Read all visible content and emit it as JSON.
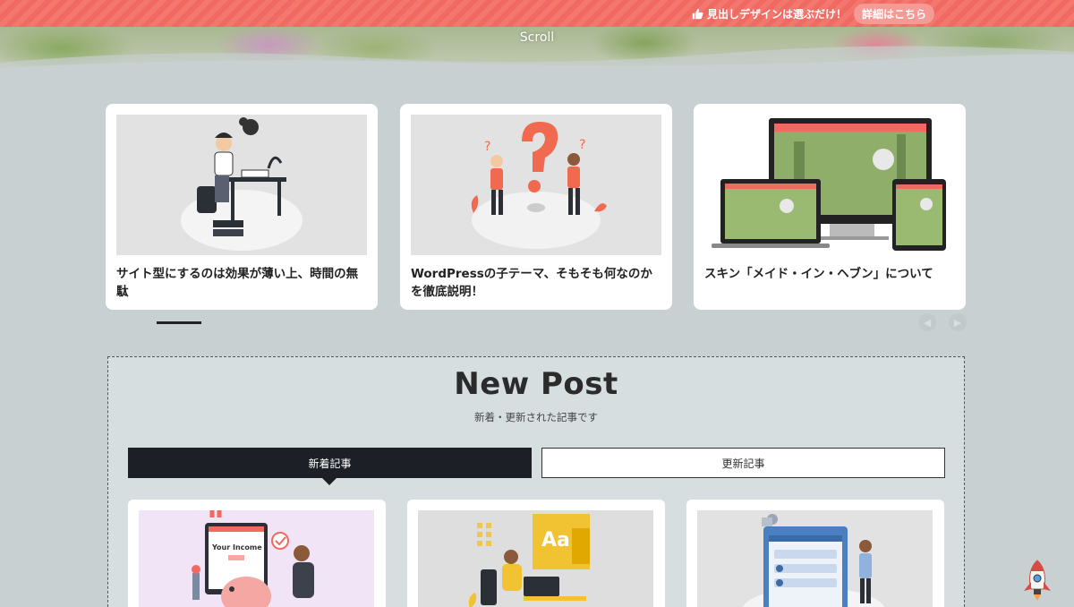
{
  "topbar": {
    "message": "見出しデザインは選ぶだけ！",
    "button_label": "詳細はこちら"
  },
  "hero": {
    "scroll_label": "Scroll"
  },
  "carousel": {
    "slides": [
      {
        "title": "サイト型にするのは効果が薄い上、時間の無駄",
        "icon": "person-at-desk-illustration"
      },
      {
        "title": "WordPressの子テーマ、そもそも何なのかを徹底説明！",
        "icon": "question-mark-illustration"
      },
      {
        "title": "スキン「メイド・イン・ヘブン」について",
        "icon": "responsive-devices-illustration"
      }
    ]
  },
  "new_post": {
    "heading": "New Post",
    "subheading": "新着・更新された記事です",
    "tabs": [
      {
        "label": "新着記事",
        "active": true
      },
      {
        "label": "更新記事",
        "active": false
      }
    ],
    "cards": [
      {
        "icon": "income-piggybank-illustration",
        "text": "Your Income"
      },
      {
        "icon": "font-design-illustration",
        "text": "Aa"
      },
      {
        "icon": "web-interface-illustration"
      }
    ]
  },
  "colors": {
    "accent": "#f06a62",
    "dark": "#1c1f26",
    "background": "#c8d0d2"
  }
}
